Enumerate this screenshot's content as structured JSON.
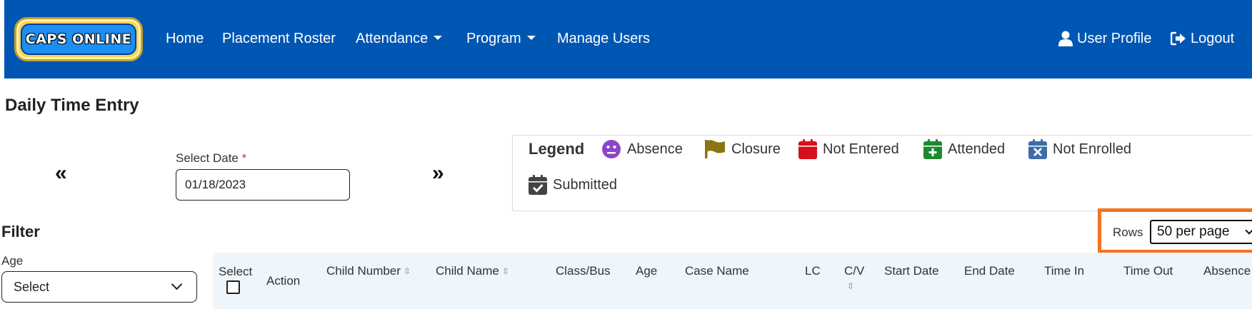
{
  "navbar": {
    "logo_text": "CAPS ONLINE",
    "links": {
      "home": "Home",
      "placement_roster": "Placement Roster",
      "attendance": "Attendance",
      "program": "Program",
      "manage_users": "Manage Users"
    },
    "user_profile": "User Profile",
    "logout": "Logout",
    "bg_color": "#0056b3"
  },
  "page": {
    "title": "Daily Time Entry"
  },
  "date_nav": {
    "prev_glyph": "«",
    "next_glyph": "»",
    "label": "Select Date",
    "required_mark": "*",
    "value": "01/18/2023"
  },
  "legend": {
    "title": "Legend",
    "items": [
      {
        "label": "Absence",
        "icon": "face-neutral-icon",
        "color": "#8e44c9"
      },
      {
        "label": "Closure",
        "icon": "flag-icon",
        "color": "#8a7512"
      },
      {
        "label": "Not Entered",
        "icon": "calendar-icon",
        "color": "#d6101a"
      },
      {
        "label": "Attended",
        "icon": "calendar-plus-icon",
        "color": "#1b8a2e"
      },
      {
        "label": "Not Enrolled",
        "icon": "calendar-x-icon",
        "color": "#3b6da8"
      },
      {
        "label": "Submitted",
        "icon": "calendar-check-icon",
        "color": "#444444"
      }
    ]
  },
  "filter": {
    "title": "Filter",
    "age_label": "Age",
    "age_value": "Select"
  },
  "rows": {
    "label": "Rows",
    "value": "50 per page",
    "highlight_color": "#f27321"
  },
  "table": {
    "select_label": "Select",
    "columns": {
      "action": "Action",
      "child_number": "Child Number",
      "child_name": "Child Name",
      "class_bus": "Class/Bus",
      "age": "Age",
      "case_name": "Case Name",
      "lc": "LC",
      "cv": "C/V",
      "start_date": "Start Date",
      "end_date": "End Date",
      "time_in": "Time In",
      "time_out": "Time Out",
      "absence": "Absence"
    },
    "sort_glyph": "⇳"
  }
}
